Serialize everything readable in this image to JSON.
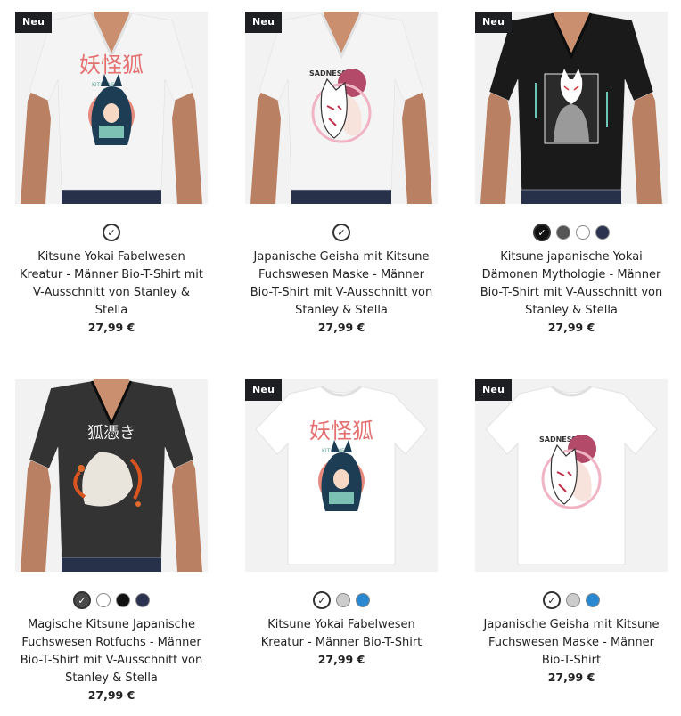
{
  "products": [
    {
      "badge": "Neu",
      "shirt": "white-vneck",
      "print": "kitsune-yokai",
      "swatches": [
        {
          "color": "#ffffff",
          "selected": true
        }
      ],
      "title": "Kitsune Yokai Fabelwesen Kreatur - Männer Bio-T-Shirt mit V-Ausschnitt von Stanley & Stella",
      "price": "27,99 €"
    },
    {
      "badge": "Neu",
      "shirt": "white-vneck",
      "print": "geisha-mask",
      "swatches": [
        {
          "color": "#ffffff",
          "selected": true
        }
      ],
      "title": "Japanische Geisha mit Kitsune Fuchswesen Maske - Männer Bio-T-Shirt mit V-Ausschnitt von Stanley & Stella",
      "price": "27,99 €"
    },
    {
      "badge": "Neu",
      "shirt": "black-vneck",
      "print": "kitsune-mythologie",
      "swatches": [
        {
          "color": "#111111",
          "selected": true
        },
        {
          "color": "#555555",
          "selected": false
        },
        {
          "color": "#ffffff",
          "selected": false
        },
        {
          "color": "#2b3350",
          "selected": false
        }
      ],
      "title": "Kitsune japanische Yokai Dämonen Mythologie - Männer Bio-T-Shirt mit V-Ausschnitt von Stanley & Stella",
      "price": "27,99 €"
    },
    {
      "badge": "",
      "shirt": "darkgrey-vneck",
      "print": "rotfuchs",
      "swatches": [
        {
          "color": "#4a4a4a",
          "selected": true
        },
        {
          "color": "#ffffff",
          "selected": false
        },
        {
          "color": "#111111",
          "selected": false
        },
        {
          "color": "#2b3350",
          "selected": false
        }
      ],
      "title": "Magische Kitsune Japanische Fuchswesen Rotfuchs - Männer Bio-T-Shirt mit V-Ausschnitt von Stanley & Stella",
      "price": "27,99 €"
    },
    {
      "badge": "Neu",
      "shirt": "white-crew",
      "print": "kitsune-yokai",
      "swatches": [
        {
          "color": "#ffffff",
          "selected": true
        },
        {
          "color": "#cccccc",
          "selected": false
        },
        {
          "color": "#2a88d0",
          "selected": false
        }
      ],
      "title": "Kitsune Yokai Fabelwesen Kreatur - Männer Bio-T-Shirt",
      "price": "27,99 €"
    },
    {
      "badge": "Neu",
      "shirt": "white-crew",
      "print": "geisha-mask",
      "swatches": [
        {
          "color": "#ffffff",
          "selected": true
        },
        {
          "color": "#cccccc",
          "selected": false
        },
        {
          "color": "#2a88d0",
          "selected": false
        }
      ],
      "title": "Japanische Geisha mit Kitsune Fuchswesen Maske - Männer Bio-T-Shirt",
      "price": "27,99 €"
    }
  ],
  "print_text": {
    "kitsune_kanji": "妖怪狐",
    "kitsune_sub": "KITSUNE",
    "geisha_word": "SADNESS",
    "rotfuchs_kanji": "狐憑き"
  }
}
